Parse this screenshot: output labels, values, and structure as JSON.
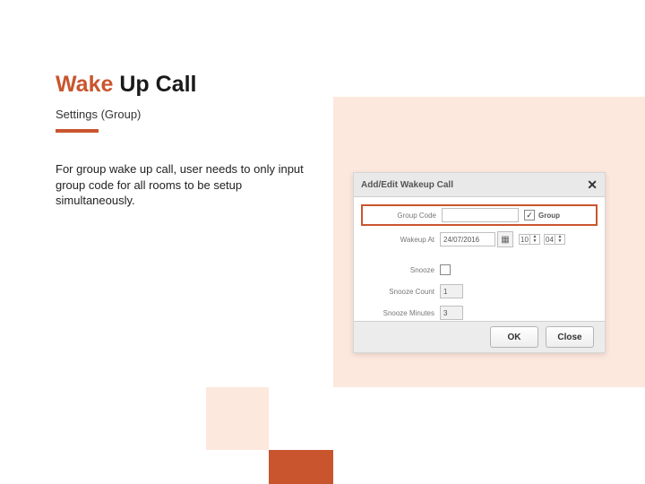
{
  "title_prefix": "Wake",
  "title_rest": " Up Call",
  "subtitle": "Settings (Group)",
  "description": "For group wake up call, user needs to only input group code for all rooms to be setup simultaneously.",
  "dialog": {
    "title": "Add/Edit Wakeup Call",
    "close": "✕",
    "labels": {
      "group_code": "Group Code",
      "wakeup_at": "Wakeup At",
      "snooze": "Snooze",
      "snooze_count": "Snooze Count",
      "snooze_minutes": "Snooze Minutes",
      "group_chk": "Group"
    },
    "values": {
      "group_code": "",
      "date": "24/07/2016",
      "hour": "10",
      "minute": "04",
      "snooze_count": "1",
      "snooze_minutes": "3",
      "group_checked": "✓"
    },
    "buttons": {
      "ok": "OK",
      "close": "Close"
    }
  }
}
